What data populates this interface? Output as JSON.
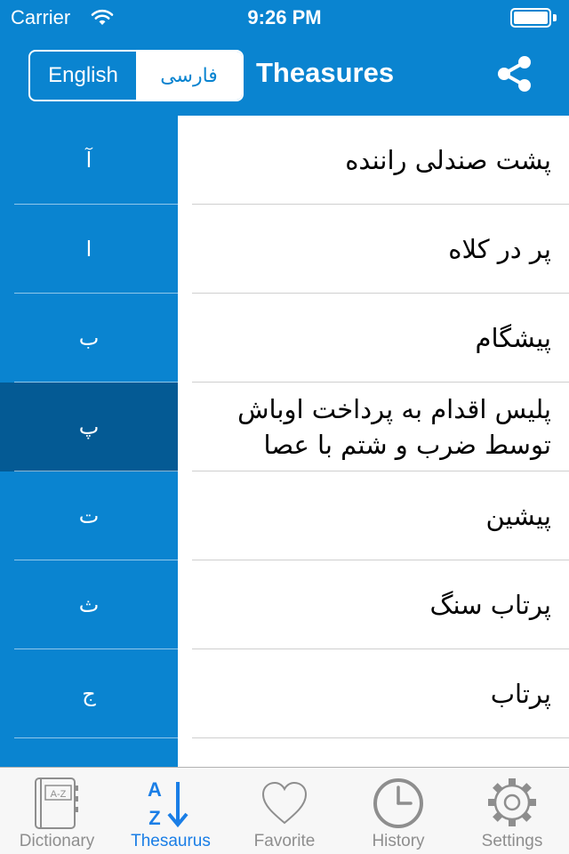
{
  "status_bar": {
    "carrier": "Carrier",
    "time": "9:26 PM"
  },
  "nav": {
    "segments": [
      "English",
      "فارسی"
    ],
    "selected_segment": "فارسی",
    "title": "Theasures",
    "share_icon": "share-icon"
  },
  "alphabet_index": {
    "letters": [
      "آ",
      "ا",
      "ب",
      "پ",
      "ت",
      "ث",
      "ج"
    ],
    "selected": "پ"
  },
  "words": [
    "پشت صندلی راننده",
    "پر در کلاه",
    "پیشگام",
    "پلیس اقدام به پرداخت اوباش توسط ضرب و شتم با عصا",
    "پیشین",
    "پرتاب سنگ",
    "پرتاب"
  ],
  "tab_bar": {
    "tabs": [
      {
        "label": "Dictionary",
        "icon": "dictionary-book-icon"
      },
      {
        "label": "Thesaurus",
        "icon": "az-sort-icon"
      },
      {
        "label": "Favorite",
        "icon": "heart-icon"
      },
      {
        "label": "History",
        "icon": "clock-icon"
      },
      {
        "label": "Settings",
        "icon": "gear-icon"
      }
    ],
    "selected": "Thesaurus"
  },
  "colors": {
    "brand_blue": "#0a84d0",
    "index_selected": "#045a94",
    "tab_active": "#1a7ee6",
    "tab_inactive": "#8e8e8e"
  }
}
